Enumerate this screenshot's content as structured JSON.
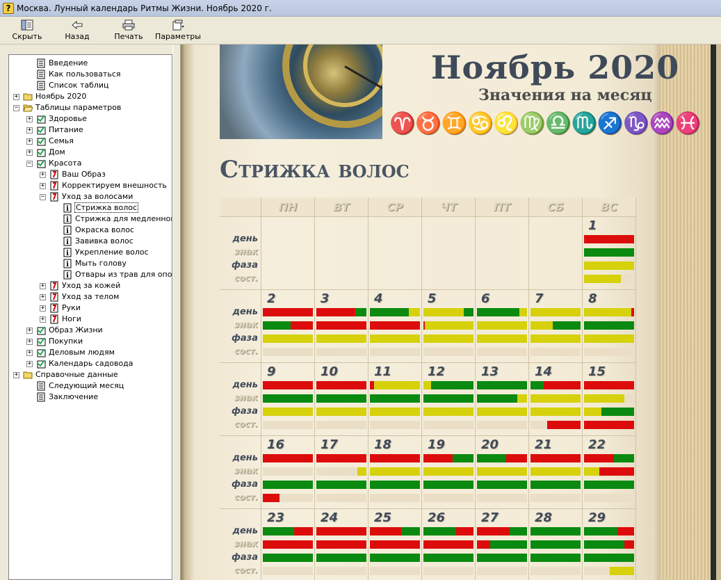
{
  "window": {
    "title": "Москва. Лунный календарь Ритмы Жизни. Ноябрь 2020 г.",
    "app_icon": "?"
  },
  "toolbar": {
    "hide_label": "Скрыть",
    "back_label": "Назад",
    "print_label": "Печать",
    "options_label": "Параметры"
  },
  "sidebar": {
    "items": [
      {
        "label": "Введение",
        "icon": "page-icon",
        "exp": ""
      },
      {
        "label": "Как пользоваться",
        "icon": "page-icon",
        "exp": ""
      },
      {
        "label": "Список таблиц",
        "icon": "page-icon",
        "exp": ""
      },
      {
        "label": "Ноябрь 2020",
        "icon": "folder-icon",
        "exp": "+"
      },
      {
        "label": "Таблицы параметров",
        "icon": "folder-open-icon",
        "exp": "−"
      },
      {
        "label": "Здоровье",
        "icon": "checklist-icon",
        "exp": "+"
      },
      {
        "label": "Питание",
        "icon": "checklist-icon",
        "exp": "+"
      },
      {
        "label": "Семья",
        "icon": "checklist-icon",
        "exp": "+"
      },
      {
        "label": "Дом",
        "icon": "checklist-icon",
        "exp": "+"
      },
      {
        "label": "Красота",
        "icon": "checklist-icon",
        "exp": "−"
      },
      {
        "label": "Ваш Образ",
        "icon": "book-icon",
        "exp": "+"
      },
      {
        "label": "Корректируем внешность",
        "icon": "book-icon",
        "exp": "+"
      },
      {
        "label": "Уход за волосами",
        "icon": "book-icon",
        "exp": "−"
      },
      {
        "label": "Стрижка волос",
        "icon": "info-icon",
        "exp": ""
      },
      {
        "label": "Стрижка для медленного",
        "icon": "info-icon",
        "exp": ""
      },
      {
        "label": "Окраска волос",
        "icon": "info-icon",
        "exp": ""
      },
      {
        "label": "Завивка волос",
        "icon": "info-icon",
        "exp": ""
      },
      {
        "label": "Укрепление волос",
        "icon": "info-icon",
        "exp": ""
      },
      {
        "label": "Мыть голову",
        "icon": "info-icon",
        "exp": ""
      },
      {
        "label": "Отвары из трав для опол",
        "icon": "info-icon",
        "exp": ""
      },
      {
        "label": "Уход за кожей",
        "icon": "book-icon",
        "exp": "+"
      },
      {
        "label": "Уход за телом",
        "icon": "book-icon",
        "exp": "+"
      },
      {
        "label": "Руки",
        "icon": "book-icon",
        "exp": "+"
      },
      {
        "label": "Ноги",
        "icon": "book-icon",
        "exp": "+"
      },
      {
        "label": "Образ Жизни",
        "icon": "checklist-icon",
        "exp": "+"
      },
      {
        "label": "Покупки",
        "icon": "checklist-icon",
        "exp": "+"
      },
      {
        "label": "Деловым людям",
        "icon": "checklist-icon",
        "exp": "+"
      },
      {
        "label": "Календарь садовода",
        "icon": "checklist-icon",
        "exp": "+"
      },
      {
        "label": "Справочные данные",
        "icon": "folder-icon",
        "exp": "+"
      },
      {
        "label": "Следующий месяц",
        "icon": "page-icon",
        "exp": ""
      },
      {
        "label": "Заключение",
        "icon": "page-icon",
        "exp": ""
      }
    ],
    "selected": "Стрижка волос"
  },
  "page": {
    "month_title": "Ноябрь 2020",
    "subtitle": "Значения на месяц",
    "zodiac_glyphs": "♈♉♊♋♌♍♎♏♐♑♒♓",
    "section_title": "Стрижка волос"
  },
  "calendar": {
    "weekdays": [
      "ПН",
      "ВТ",
      "СР",
      "ЧТ",
      "ПТ",
      "СБ",
      "ВС"
    ],
    "row_labels": {
      "day": "день",
      "sign": "знак",
      "phase": "фаза",
      "state": "сост."
    },
    "colors": {
      "red": "#dd0c0c",
      "green": "#0a8a10",
      "yellow": "#d6d10b",
      "empty": "#eadfc6"
    },
    "weeks": [
      {
        "days": [
          {
            "num": ""
          },
          {
            "num": ""
          },
          {
            "num": ""
          },
          {
            "num": ""
          },
          {
            "num": ""
          },
          {
            "num": ""
          },
          {
            "num": "1",
            "bars": [
              [
                [
                  "r",
                  1
                ]
              ],
              [
                [
                  "g",
                  1
                ]
              ],
              [
                [
                  "y",
                  1
                ]
              ],
              [
                [
                  "y",
                  0.73
                ]
              ]
            ]
          }
        ]
      },
      {
        "days": [
          {
            "num": "2",
            "bars": [
              [
                [
                  "r",
                  1
                ]
              ],
              [
                [
                  "g",
                  0.55
                ],
                [
                  "r",
                  0.45
                ]
              ],
              [
                [
                  "y",
                  1
                ]
              ],
              []
            ]
          },
          {
            "num": "3",
            "bars": [
              [
                [
                  "r",
                  0.78
                ],
                [
                  "g",
                  0.22
                ]
              ],
              [
                [
                  "r",
                  1
                ]
              ],
              [
                [
                  "y",
                  1
                ]
              ],
              []
            ]
          },
          {
            "num": "4",
            "bars": [
              [
                [
                  "g",
                  0.78
                ],
                [
                  "y",
                  0.22
                ]
              ],
              [
                [
                  "r",
                  1
                ]
              ],
              [
                [
                  "y",
                  1
                ]
              ],
              []
            ]
          },
          {
            "num": "5",
            "bars": [
              [
                [
                  "y",
                  0.8
                ],
                [
                  "g",
                  0.2
                ]
              ],
              [
                [
                  "r",
                  0.03
                ],
                [
                  "y",
                  0.97
                ]
              ],
              [
                [
                  "y",
                  1
                ]
              ],
              []
            ]
          },
          {
            "num": "6",
            "bars": [
              [
                [
                  "g",
                  0.85
                ],
                [
                  "y",
                  0.15
                ]
              ],
              [
                [
                  "y",
                  1
                ]
              ],
              [
                [
                  "y",
                  1
                ]
              ],
              []
            ]
          },
          {
            "num": "7",
            "bars": [
              [
                [
                  "y",
                  1
                ]
              ],
              [
                [
                  "y",
                  0.45
                ],
                [
                  "g",
                  0.55
                ]
              ],
              [
                [
                  "y",
                  1
                ]
              ],
              []
            ]
          },
          {
            "num": "8",
            "bars": [
              [
                [
                  "y",
                  0.95
                ],
                [
                  "r",
                  0.05
                ]
              ],
              [
                [
                  "g",
                  1
                ]
              ],
              [
                [
                  "y",
                  1
                ]
              ],
              []
            ]
          }
        ]
      },
      {
        "days": [
          {
            "num": "9",
            "bars": [
              [
                [
                  "r",
                  1
                ]
              ],
              [
                [
                  "g",
                  1
                ]
              ],
              [
                [
                  "y",
                  1
                ]
              ],
              []
            ]
          },
          {
            "num": "10",
            "bars": [
              [
                [
                  "r",
                  1
                ]
              ],
              [
                [
                  "g",
                  1
                ]
              ],
              [
                [
                  "y",
                  1
                ]
              ],
              []
            ]
          },
          {
            "num": "11",
            "bars": [
              [
                [
                  "r",
                  0.08
                ],
                [
                  "y",
                  0.92
                ]
              ],
              [
                [
                  "g",
                  1
                ]
              ],
              [
                [
                  "y",
                  1
                ]
              ],
              []
            ]
          },
          {
            "num": "12",
            "bars": [
              [
                [
                  "y",
                  0.15
                ],
                [
                  "g",
                  0.85
                ]
              ],
              [
                [
                  "g",
                  1
                ]
              ],
              [
                [
                  "y",
                  1
                ]
              ],
              []
            ]
          },
          {
            "num": "13",
            "bars": [
              [
                [
                  "g",
                  1
                ]
              ],
              [
                [
                  "g",
                  0.8
                ],
                [
                  "y",
                  0.2
                ]
              ],
              [
                [
                  "y",
                  1
                ]
              ],
              []
            ]
          },
          {
            "num": "14",
            "bars": [
              [
                [
                  "g",
                  0.27
                ],
                [
                  "r",
                  0.73
                ]
              ],
              [
                [
                  "y",
                  1
                ]
              ],
              [
                [
                  "y",
                  1
                ]
              ],
              [
                [
                  "empty",
                  0.33
                ],
                [
                  "r",
                  0.67
                ]
              ]
            ]
          },
          {
            "num": "15",
            "bars": [
              [
                [
                  "r",
                  1
                ]
              ],
              [
                [
                  "y",
                  0.8
                ]
              ],
              [
                [
                  "y",
                  0.35
                ],
                [
                  "g",
                  0.65
                ]
              ],
              [
                [
                  "r",
                  1
                ]
              ]
            ]
          }
        ]
      },
      {
        "days": [
          {
            "num": "16",
            "bars": [
              [
                [
                  "r",
                  1
                ]
              ],
              [],
              [
                [
                  "g",
                  1
                ]
              ],
              [
                [
                  "r",
                  0.33
                ]
              ]
            ]
          },
          {
            "num": "17",
            "bars": [
              [
                [
                  "r",
                  1
                ]
              ],
              [
                [
                  "empty",
                  0.82
                ],
                [
                  "y",
                  0.18
                ]
              ],
              [
                [
                  "g",
                  1
                ]
              ],
              []
            ]
          },
          {
            "num": "18",
            "bars": [
              [
                [
                  "r",
                  1
                ]
              ],
              [
                [
                  "y",
                  1
                ]
              ],
              [
                [
                  "g",
                  1
                ]
              ],
              []
            ]
          },
          {
            "num": "19",
            "bars": [
              [
                [
                  "r",
                  0.58
                ],
                [
                  "g",
                  0.42
                ]
              ],
              [
                [
                  "y",
                  1
                ]
              ],
              [
                [
                  "g",
                  1
                ]
              ],
              []
            ]
          },
          {
            "num": "20",
            "bars": [
              [
                [
                  "g",
                  0.58
                ],
                [
                  "r",
                  0.42
                ]
              ],
              [
                [
                  "y",
                  1
                ]
              ],
              [
                [
                  "g",
                  1
                ]
              ],
              []
            ]
          },
          {
            "num": "21",
            "bars": [
              [
                [
                  "r",
                  1
                ]
              ],
              [
                [
                  "y",
                  1
                ]
              ],
              [
                [
                  "g",
                  1
                ]
              ],
              []
            ]
          },
          {
            "num": "22",
            "bars": [
              [
                [
                  "r",
                  0.6
                ],
                [
                  "g",
                  0.4
                ]
              ],
              [
                [
                  "y",
                  0.3
                ],
                [
                  "r",
                  0.7
                ]
              ],
              [
                [
                  "g",
                  1
                ]
              ],
              []
            ]
          }
        ]
      },
      {
        "days": [
          {
            "num": "23",
            "bars": [
              [
                [
                  "g",
                  0.62
                ],
                [
                  "r",
                  0.38
                ]
              ],
              [
                [
                  "r",
                  1
                ]
              ],
              [
                [
                  "g",
                  1
                ]
              ],
              []
            ]
          },
          {
            "num": "24",
            "bars": [
              [
                [
                  "r",
                  1
                ]
              ],
              [
                [
                  "r",
                  1
                ]
              ],
              [
                [
                  "g",
                  1
                ]
              ],
              []
            ]
          },
          {
            "num": "25",
            "bars": [
              [
                [
                  "r",
                  0.62
                ],
                [
                  "g",
                  0.38
                ]
              ],
              [
                [
                  "r",
                  1
                ]
              ],
              [
                [
                  "g",
                  1
                ]
              ],
              []
            ]
          },
          {
            "num": "26",
            "bars": [
              [
                [
                  "g",
                  0.65
                ],
                [
                  "r",
                  0.35
                ]
              ],
              [
                [
                  "r",
                  1
                ]
              ],
              [
                [
                  "g",
                  1
                ]
              ],
              []
            ]
          },
          {
            "num": "27",
            "bars": [
              [
                [
                  "r",
                  0.65
                ],
                [
                  "g",
                  0.35
                ]
              ],
              [
                [
                  "r",
                  0.27
                ],
                [
                  "g",
                  0.73
                ]
              ],
              [
                [
                  "g",
                  1
                ]
              ],
              []
            ]
          },
          {
            "num": "28",
            "bars": [
              [
                [
                  "g",
                  1
                ]
              ],
              [
                [
                  "g",
                  1
                ]
              ],
              [
                [
                  "g",
                  1
                ]
              ],
              []
            ]
          },
          {
            "num": "29",
            "bars": [
              [
                [
                  "g",
                  0.67
                ],
                [
                  "r",
                  0.33
                ]
              ],
              [
                [
                  "g",
                  0.8
                ],
                [
                  "r",
                  0.2
                ]
              ],
              [
                [
                  "g",
                  1
                ]
              ],
              [
                [
                  "empty",
                  0.52
                ],
                [
                  "y",
                  0.48
                ]
              ]
            ]
          }
        ]
      }
    ]
  }
}
